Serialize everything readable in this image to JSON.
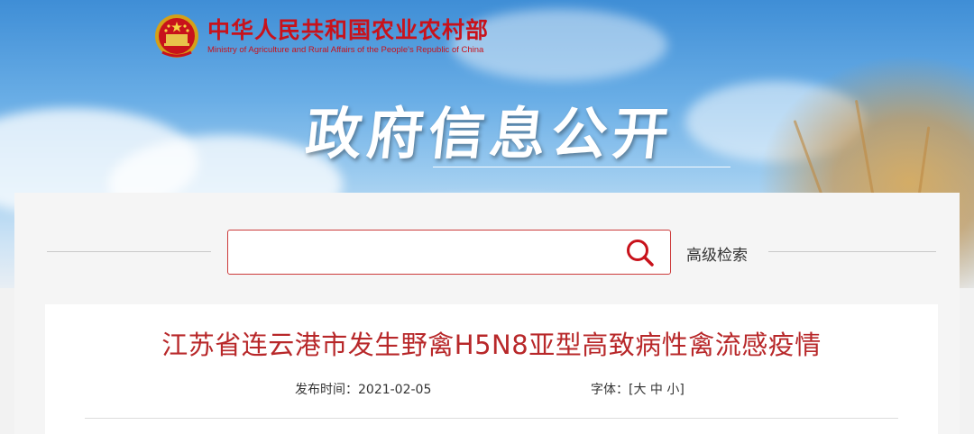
{
  "header": {
    "ministry_name_cn": "中华人民共和国农业农村部",
    "ministry_name_en": "Ministry of Agriculture and Rural Affairs of the People's Republic of China",
    "section_title": "政府信息公开"
  },
  "search": {
    "placeholder": "",
    "advanced_label": "高级检索"
  },
  "article": {
    "title": "江苏省连云港市发生野禽H5N8亚型高致病性禽流感疫情",
    "date_label": "发布时间：",
    "date": "2021-02-05",
    "font_label": "字体：",
    "font_sizes": [
      "大",
      "中",
      "小"
    ]
  },
  "colors": {
    "brand_red": "#c8121b",
    "title_red": "#b8282a",
    "search_border": "#cc3b3b"
  }
}
